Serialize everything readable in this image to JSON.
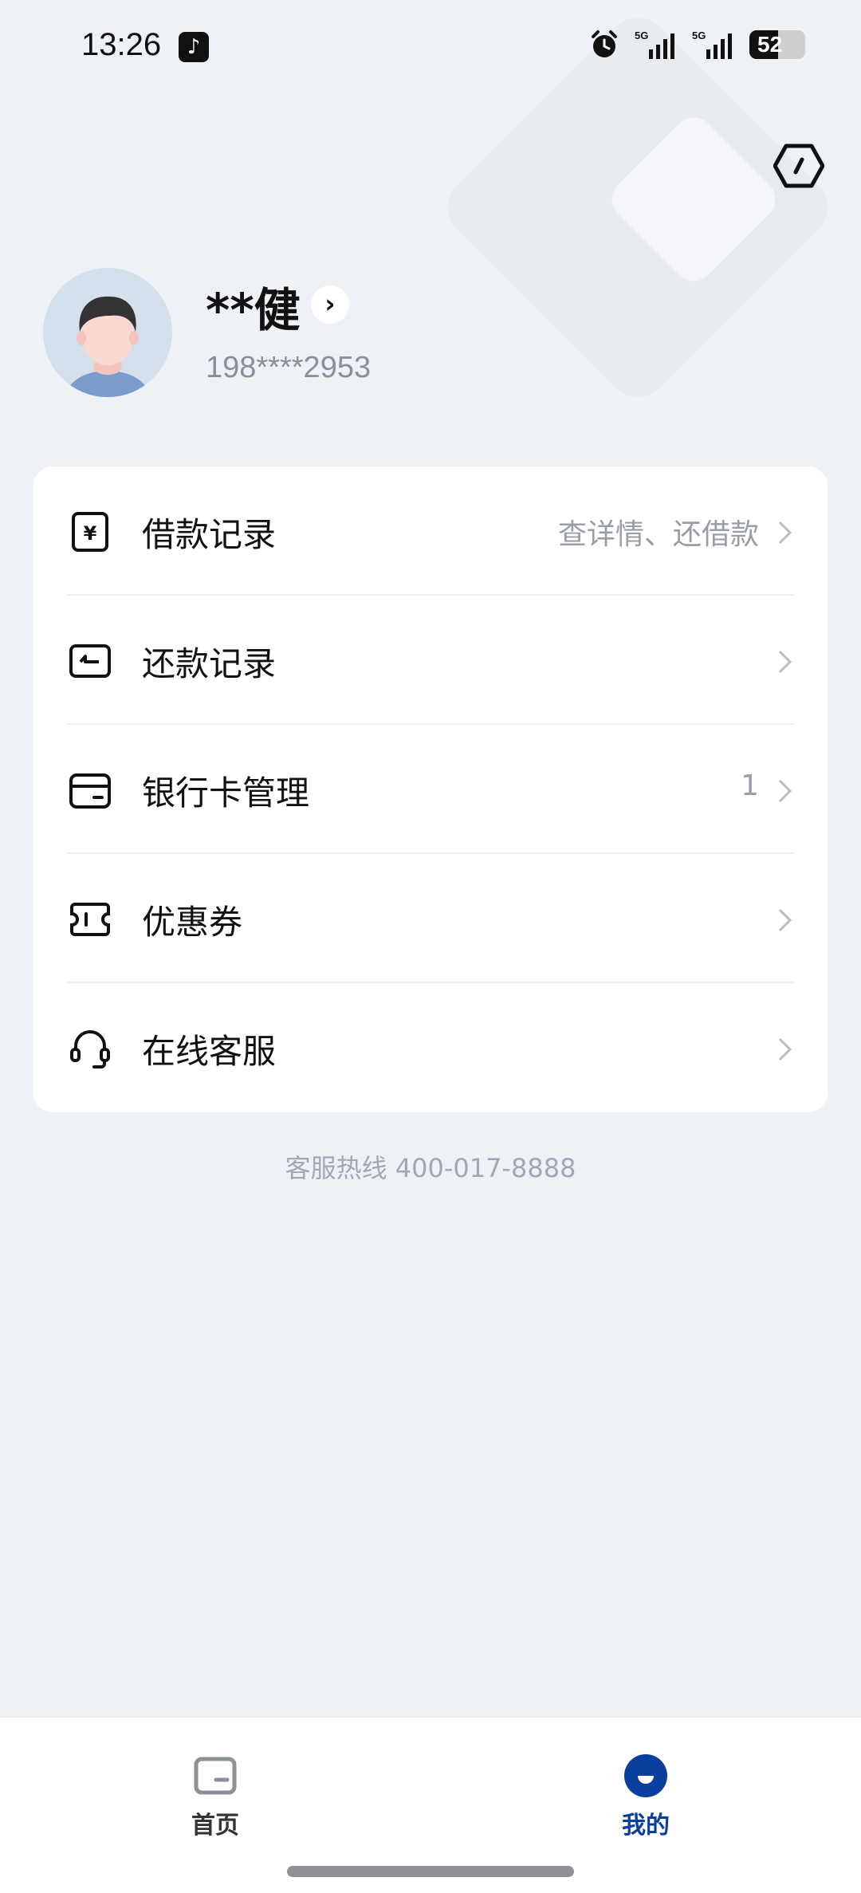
{
  "status_bar": {
    "time": "13:26",
    "network1": "5G",
    "network2": "5G",
    "battery": "52",
    "battery_level": 0.52
  },
  "profile": {
    "name": "**健",
    "phone": "198****2953"
  },
  "menu": {
    "items": [
      {
        "label": "借款记录",
        "extra": "查详情、还借款",
        "icon": "loan-icon"
      },
      {
        "label": "还款记录",
        "extra": "",
        "icon": "repayment-icon"
      },
      {
        "label": "银行卡管理",
        "extra": "1",
        "icon": "bank-card-icon"
      },
      {
        "label": "优惠券",
        "extra": "",
        "icon": "coupon-icon"
      },
      {
        "label": "在线客服",
        "extra": "",
        "icon": "headset-icon"
      }
    ]
  },
  "hotline": "客服热线 400-017-8888",
  "nav": {
    "home_label": "首页",
    "mine_label": "我的",
    "active": "mine",
    "active_color": "#0a3fa0"
  }
}
